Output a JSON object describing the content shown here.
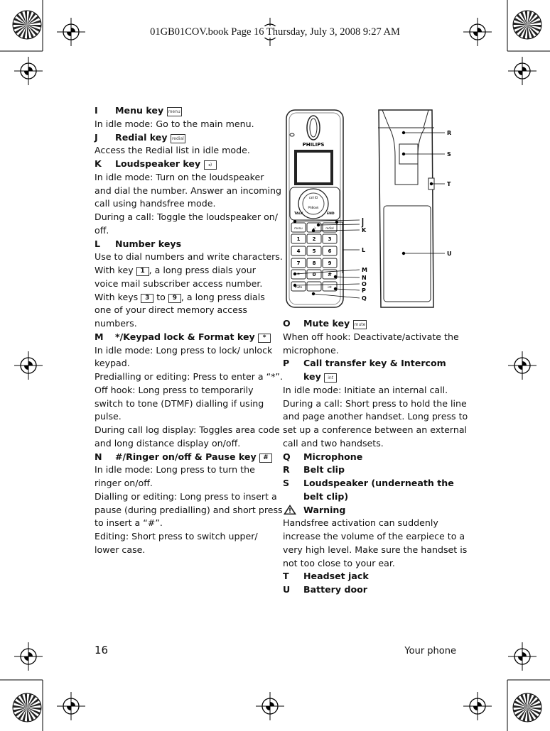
{
  "header": "01GB01COV.book  Page 16  Thursday, July 3, 2008  9:27 AM",
  "footer": {
    "page_number": "16",
    "section": "Your phone"
  },
  "left_column": [
    {
      "letter": "I",
      "title": [
        "Menu key"
      ],
      "key": "menu",
      "body": [
        [
          {
            "t": "In idle mode: Go to the main menu."
          }
        ]
      ]
    },
    {
      "letter": "J",
      "title": [
        "Redial key"
      ],
      "key": "redial",
      "body": [
        [
          {
            "t": "Access the Redial list in idle mode."
          }
        ]
      ]
    },
    {
      "letter": "K",
      "title": [
        "Loudspeaker key"
      ],
      "key": "◂)",
      "body": [
        [
          {
            "t": "In idle mode: Turn on the loudspeaker"
          }
        ],
        [
          {
            "t": "and dial the number. Answer an incoming"
          }
        ],
        [
          {
            "t": "call using handsfree mode."
          }
        ],
        [
          {
            "t": "During a call: Toggle the loudspeaker on/"
          }
        ],
        [
          {
            "t": "off."
          }
        ]
      ]
    },
    {
      "letter": "L",
      "title": [
        "Number keys"
      ],
      "body": [
        [
          {
            "t": "Use to dial numbers and write characters."
          }
        ],
        [
          {
            "t": "With key "
          },
          {
            "k": "1"
          },
          {
            "t": ", a long press dials your"
          }
        ],
        [
          {
            "t": "voice mail subscriber access number."
          }
        ],
        [
          {
            "t": "With keys "
          },
          {
            "k": "3"
          },
          {
            "t": " to "
          },
          {
            "k": "9"
          },
          {
            "t": ", a long press dials"
          }
        ],
        [
          {
            "t": "one of your direct memory access"
          }
        ],
        [
          {
            "t": "numbers."
          }
        ]
      ]
    },
    {
      "letter": "M",
      "title": [
        "*/Keypad lock & Format key"
      ],
      "key": "*",
      "body": [
        [
          {
            "t": "In idle mode: Long press to lock/ unlock"
          }
        ],
        [
          {
            "t": "keypad."
          }
        ],
        [
          {
            "t": "Predialling or editing: Press to enter a “*”."
          }
        ],
        [
          {
            "t": "Off hook: Long press to temporarily"
          }
        ],
        [
          {
            "t": "switch to tone (DTMF) dialling if using"
          }
        ],
        [
          {
            "t": "pulse."
          }
        ],
        [
          {
            "t": "During call log display: Toggles area code"
          }
        ],
        [
          {
            "t": "and long distance display on/off."
          }
        ]
      ]
    },
    {
      "letter": "N",
      "title": [
        "#/Ringer on/off & Pause key"
      ],
      "key": "#",
      "body": [
        [
          {
            "t": "In idle mode: Long press to turn the"
          }
        ],
        [
          {
            "t": "ringer on/off."
          }
        ],
        [
          {
            "t": "Dialling or editing: Long press to insert a"
          }
        ],
        [
          {
            "t": "pause (during predialling) and short press"
          }
        ],
        [
          {
            "t": "to insert a “#”."
          }
        ],
        [
          {
            "t": "Editing: Short press to switch upper/"
          }
        ],
        [
          {
            "t": "lower case."
          }
        ]
      ]
    }
  ],
  "right_column": [
    {
      "letter": "O",
      "title": [
        "Mute key"
      ],
      "key": "mute",
      "body": [
        [
          {
            "t": "When off hook: Deactivate/activate the"
          }
        ],
        [
          {
            "t": "microphone."
          }
        ]
      ]
    },
    {
      "letter": "P",
      "title": [
        "Call transfer key & Intercom",
        "key"
      ],
      "key": "int",
      "body": [
        [
          {
            "t": "In idle mode: Initiate an internal call."
          }
        ],
        [
          {
            "t": "During a call: Short press to hold the line"
          }
        ],
        [
          {
            "t": "and page another handset. Long press to"
          }
        ],
        [
          {
            "t": "set up a conference between an external"
          }
        ],
        [
          {
            "t": "call and two handsets."
          }
        ]
      ]
    },
    {
      "letter": "Q",
      "title": [
        "Microphone"
      ],
      "body": []
    },
    {
      "letter": "R",
      "title": [
        "Belt clip"
      ],
      "body": []
    },
    {
      "letter": "S",
      "title": [
        "Loudspeaker (underneath the",
        "belt clip)"
      ],
      "body": []
    },
    {
      "warning": true,
      "title": [
        "Warning"
      ],
      "body": [
        [
          {
            "t": "Handsfree activation can suddenly"
          }
        ],
        [
          {
            "t": "increase the volume of the earpiece to a"
          }
        ],
        [
          {
            "t": "very high level. Make sure the handset is"
          }
        ],
        [
          {
            "t": "not too close to your ear."
          }
        ]
      ]
    },
    {
      "letter": "T",
      "title": [
        "Headset jack"
      ],
      "body": []
    },
    {
      "letter": "U",
      "title": [
        "Battery door"
      ],
      "body": []
    }
  ],
  "diagram": {
    "brand": "PHILIPS",
    "callouts": [
      "I",
      "J",
      "K",
      "L",
      "M",
      "N",
      "O",
      "P",
      "Q",
      "R",
      "S",
      "T",
      "U"
    ],
    "keypad": [
      "1",
      "2",
      "3",
      "4",
      "5",
      "6",
      "7",
      "8",
      "9",
      "*",
      "0",
      "#"
    ],
    "keys": {
      "menu": "menu",
      "redial": "redial",
      "mute": "mute",
      "int": "int",
      "talk": "TALK",
      "end": "END",
      "callid": "call ID",
      "phbook": "PhBook"
    }
  }
}
